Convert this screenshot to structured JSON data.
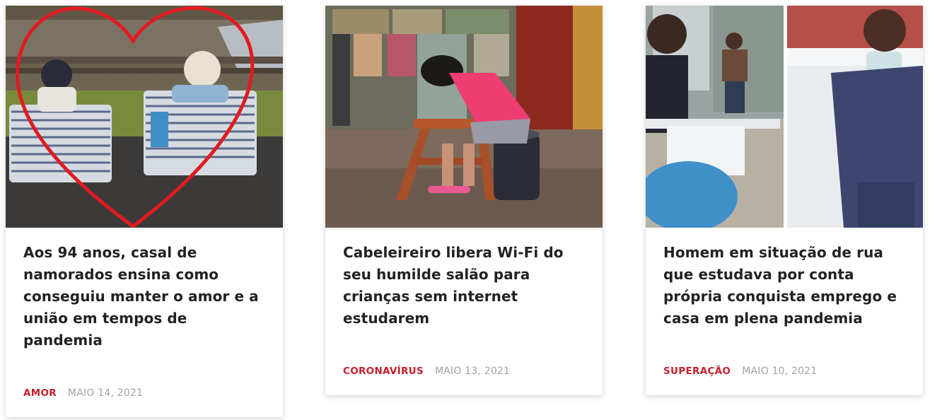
{
  "cards": [
    {
      "title": "Aos 94 anos, casal de namorados ensina como conseguiu manter o amor e a união em tempos de pandemia",
      "category": "AMOR",
      "date": "MAIO 14, 2021",
      "image_desc_icon": "elderly-couple-photo"
    },
    {
      "title": "Cabeleireiro libera Wi-Fi do seu humilde salão para crianças sem internet estudarem",
      "category": "CORONAVÍRUS",
      "date": "MAIO 13, 2021",
      "image_desc_icon": "girl-studying-photo"
    },
    {
      "title": "Homem em situação de rua que estudava por conta própria conquista emprego e casa em plena pandemia",
      "category": "SUPERAÇÃO",
      "date": "MAIO 10, 2021",
      "image_desc_icon": "man-studying-photo"
    }
  ],
  "colors": {
    "category": "#c41e2c",
    "title": "#222222",
    "date": "#a3a3a3"
  }
}
